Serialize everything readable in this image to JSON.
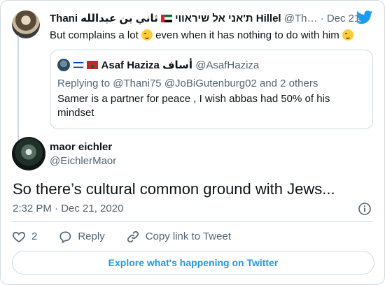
{
  "parent_tweet": {
    "display_name": "Thani ת'אני אל שיראווי",
    "display_name_suffix": "ثاني بن عبدالله Hillel",
    "handle": "@Th…",
    "separator": "·",
    "date": "Dec 21, 2020",
    "text_before": "But complains a lot",
    "text_after": "even when it has nothing to do with him"
  },
  "quoted_tweet": {
    "display_name": "Asaf Haziza",
    "display_name_arabic": "أساف",
    "handle": "@AsafHaziza",
    "replying_to": "Replying to @Thani75 @JoBiGutenburg02 and 2 others",
    "text": "Samer is a partner for peace , I wish abbas had 50% of his mindset"
  },
  "main_tweet": {
    "display_name": "maor eichler",
    "handle": "@EichlerMaor",
    "text": "So there’s cultural common ground with Jews...",
    "timestamp": "2:32 PM · Dec 21, 2020"
  },
  "actions": {
    "like_count": "2",
    "reply_label": "Reply",
    "copy_link_label": "Copy link to Tweet"
  },
  "explore_label": "Explore what's happening on Twitter",
  "colors": {
    "twitter_blue": "#1d9bf0",
    "secondary_text": "#536471",
    "border": "#cfd9de"
  },
  "icons": [
    "twitter-bird-icon",
    "wink-emoji-icon",
    "uae-flag-icon",
    "israel-flag-icon",
    "morocco-flag-icon",
    "info-icon",
    "heart-icon",
    "reply-bubble-icon",
    "link-icon"
  ]
}
